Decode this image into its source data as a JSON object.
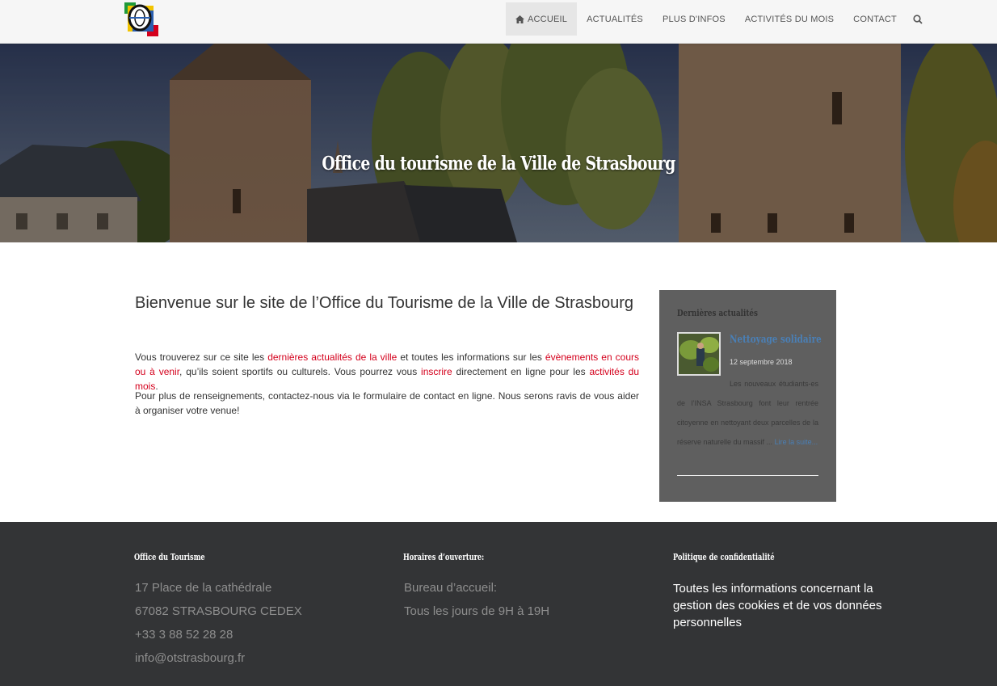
{
  "nav": {
    "items": [
      {
        "label": "ACCUEIL",
        "active": true
      },
      {
        "label": "ACTUALITÉS",
        "active": false
      },
      {
        "label": "PLUS D'INFOS",
        "active": false
      },
      {
        "label": "ACTIVITÉS DU MOIS",
        "active": false
      },
      {
        "label": "CONTACT",
        "active": false
      }
    ],
    "search_icon": "search-icon",
    "home_icon": "home-icon"
  },
  "hero": {
    "title": "Office du tourisme de la Ville de Strasbourg"
  },
  "main": {
    "welcome": "Bienvenue sur le site de l’Office du Tourisme de la Ville de Strasbourg",
    "p1": {
      "t1": "Vous trouverez sur ce site les ",
      "l1": "dernières actualités de la ville",
      "t2": " et toutes les informations sur les ",
      "l2": "évènements en cours ou à venir",
      "t3": ", qu’ils soient sportifs ou culturels. Vous pourrez vous ",
      "l3": "inscrire",
      "t4": " directement en ligne pour les ",
      "l4": "activités du mois",
      "t5": "."
    },
    "p2": "Pour plus de renseignements, contactez-nous via le formulaire de contact en ligne. Nous serons ravis de vous aider à organiser votre venue!"
  },
  "sidebar": {
    "title": "Dernières actualités",
    "news": {
      "title": "Nettoyage solidaire",
      "date": "12 septembre 2018",
      "excerpt": "Les nouveaux étudiants-es de l’INSA Strasbourg font leur rentrée citoyenne en nettoyant deux parcelles de la réserve naturelle du massif ...",
      "read_more": "Lire la suite..."
    }
  },
  "footer": {
    "col1": {
      "title": "Office du Tourisme",
      "lines": [
        "17 Place de la cathédrale",
        "67082 STRASBOURG CEDEX",
        "+33 3 88 52 28 28",
        "info@otstrasbourg.fr"
      ]
    },
    "col2": {
      "title": "Horaires d’ouverture:",
      "lines": [
        "Bureau d’accueil:",
        "Tous les jours de 9H à 19H"
      ]
    },
    "col3": {
      "title": "Politique de confidentialité",
      "text": "Toutes les informations concernant la gestion des cookies et de vos données personnelles"
    }
  },
  "colors": {
    "link_red": "#d4001c",
    "sidebar_bg": "#5f5f5f",
    "footer_bg": "#333436",
    "news_link_blue": "#4a7fb5"
  }
}
